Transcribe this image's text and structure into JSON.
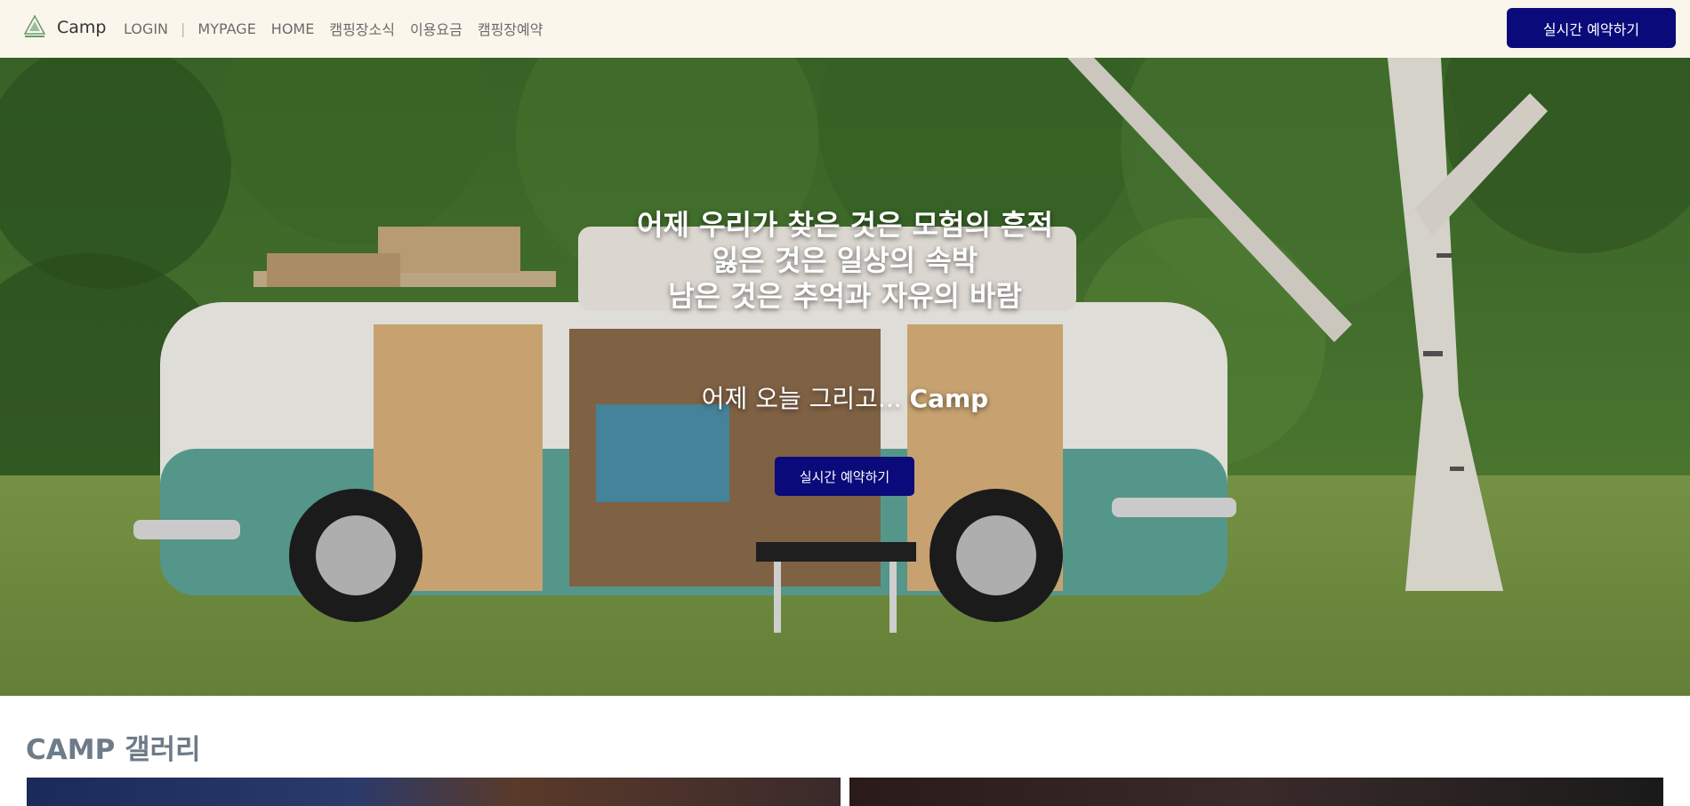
{
  "app": {
    "brand_name": "Camp"
  },
  "nav": {
    "login": "LOGIN",
    "separator": "|",
    "items": [
      "MYPAGE",
      "HOME",
      "캠핑장소식",
      "이용요금",
      "캠핑장예약"
    ],
    "cta": "실시간 예약하기"
  },
  "hero": {
    "lines": [
      "어제 우리가 찾은 것은 모험의 흔적",
      "잃은 것은 일상의 속박",
      "남은 것은 추억과 자유의 바람"
    ],
    "subtitle_prefix": "어제 오늘 그리고... ",
    "subtitle_brand": "Camp",
    "cta": "실시간 예약하기"
  },
  "gallery": {
    "title": "CAMP 갤러리"
  },
  "colors": {
    "accent": "#0a0a7a",
    "nav_bg": "#faf6ec",
    "gallery_title": "#6e7b88"
  }
}
